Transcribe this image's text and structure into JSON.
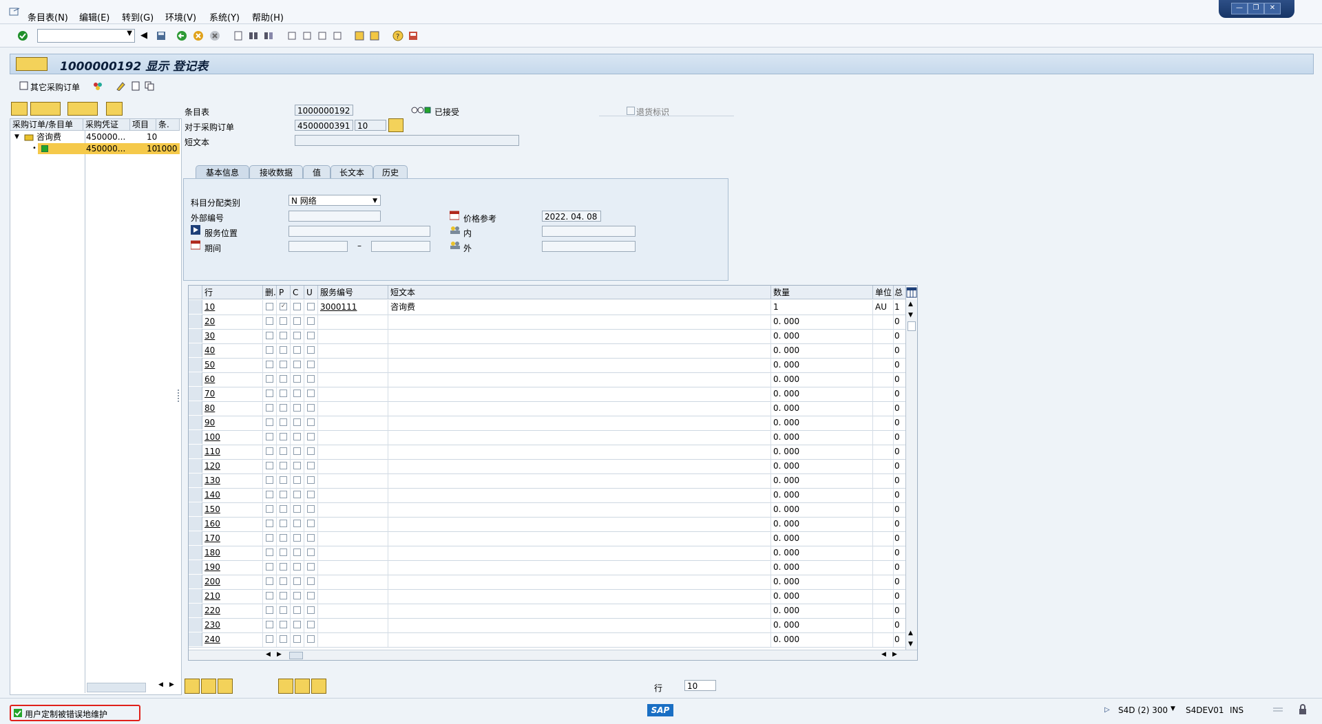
{
  "menu": {
    "items": [
      {
        "label": "条目表(N)"
      },
      {
        "label": "编辑(E)"
      },
      {
        "label": "转到(G)"
      },
      {
        "label": "环境(V)"
      },
      {
        "label": "系统(Y)"
      },
      {
        "label": "帮助(H)"
      }
    ]
  },
  "window_controls": {
    "minimize": "—",
    "restore": "❐",
    "close": "✕"
  },
  "toolbar": {
    "command_field_value": ""
  },
  "title": {
    "text": "1000000192 显示 登记表"
  },
  "app_toolbar": {
    "other_po_label": "其它采购订单"
  },
  "tree": {
    "headers": [
      "采购订单/条目单",
      "采购凭证",
      "项目",
      "条."
    ],
    "rows": [
      {
        "name": "咨询费",
        "doc": "450000...",
        "item": "10",
        "entry": ""
      },
      {
        "name": "",
        "doc": "450000...",
        "item": "10",
        "entry": "1000"
      }
    ]
  },
  "header": {
    "entry_sheet_label": "条目表",
    "entry_sheet_value": "1000000192",
    "status_label": "已接受",
    "return_label": "退货标识",
    "po_label": "对于采购订单",
    "po_value": "4500000391",
    "po_item_value": "10",
    "short_text_label": "短文本",
    "short_text_value": ""
  },
  "tabs": [
    {
      "label": "基本信息",
      "active": true
    },
    {
      "label": "接收数据",
      "active": false
    },
    {
      "label": "值",
      "active": false
    },
    {
      "label": "长文本",
      "active": false
    },
    {
      "label": "历史",
      "active": false
    }
  ],
  "basic_info": {
    "acct_assign_label": "科目分配类别",
    "acct_assign_value": "N 网络",
    "ext_number_label": "外部编号",
    "ext_number_value": "",
    "service_loc_label": "服务位置",
    "service_loc_value": "",
    "period_label": "期间",
    "period_from": "",
    "period_sep": "–",
    "period_to": "",
    "price_ref_label": "价格参考",
    "price_ref_value": "2022. 04. 08",
    "internal_label": "内",
    "internal_value": "",
    "external_label": "外",
    "external_value": ""
  },
  "table": {
    "headers": {
      "line": "行",
      "del": "删.",
      "p": "P",
      "c": "C",
      "u": "U",
      "service_no": "服务编号",
      "short_text": "短文本",
      "qty": "数量",
      "unit": "单位",
      "extra": "总"
    },
    "rows": [
      {
        "line": "10",
        "p_checked": true,
        "service_no": "3000111",
        "short_text": "咨询费",
        "qty": "1",
        "unit": "AU",
        "extra": "1"
      },
      {
        "line": "20",
        "p_checked": false,
        "service_no": "",
        "short_text": "",
        "qty": "0. 000",
        "unit": "",
        "extra": "0"
      },
      {
        "line": "30",
        "p_checked": false,
        "service_no": "",
        "short_text": "",
        "qty": "0. 000",
        "unit": "",
        "extra": "0"
      },
      {
        "line": "40",
        "p_checked": false,
        "service_no": "",
        "short_text": "",
        "qty": "0. 000",
        "unit": "",
        "extra": "0"
      },
      {
        "line": "50",
        "p_checked": false,
        "service_no": "",
        "short_text": "",
        "qty": "0. 000",
        "unit": "",
        "extra": "0"
      },
      {
        "line": "60",
        "p_checked": false,
        "service_no": "",
        "short_text": "",
        "qty": "0. 000",
        "unit": "",
        "extra": "0"
      },
      {
        "line": "70",
        "p_checked": false,
        "service_no": "",
        "short_text": "",
        "qty": "0. 000",
        "unit": "",
        "extra": "0"
      },
      {
        "line": "80",
        "p_checked": false,
        "service_no": "",
        "short_text": "",
        "qty": "0. 000",
        "unit": "",
        "extra": "0"
      },
      {
        "line": "90",
        "p_checked": false,
        "service_no": "",
        "short_text": "",
        "qty": "0. 000",
        "unit": "",
        "extra": "0"
      },
      {
        "line": "100",
        "p_checked": false,
        "service_no": "",
        "short_text": "",
        "qty": "0. 000",
        "unit": "",
        "extra": "0"
      },
      {
        "line": "110",
        "p_checked": false,
        "service_no": "",
        "short_text": "",
        "qty": "0. 000",
        "unit": "",
        "extra": "0"
      },
      {
        "line": "120",
        "p_checked": false,
        "service_no": "",
        "short_text": "",
        "qty": "0. 000",
        "unit": "",
        "extra": "0"
      },
      {
        "line": "130",
        "p_checked": false,
        "service_no": "",
        "short_text": "",
        "qty": "0. 000",
        "unit": "",
        "extra": "0"
      },
      {
        "line": "140",
        "p_checked": false,
        "service_no": "",
        "short_text": "",
        "qty": "0. 000",
        "unit": "",
        "extra": "0"
      },
      {
        "line": "150",
        "p_checked": false,
        "service_no": "",
        "short_text": "",
        "qty": "0. 000",
        "unit": "",
        "extra": "0"
      },
      {
        "line": "160",
        "p_checked": false,
        "service_no": "",
        "short_text": "",
        "qty": "0. 000",
        "unit": "",
        "extra": "0"
      },
      {
        "line": "170",
        "p_checked": false,
        "service_no": "",
        "short_text": "",
        "qty": "0. 000",
        "unit": "",
        "extra": "0"
      },
      {
        "line": "180",
        "p_checked": false,
        "service_no": "",
        "short_text": "",
        "qty": "0. 000",
        "unit": "",
        "extra": "0"
      },
      {
        "line": "190",
        "p_checked": false,
        "service_no": "",
        "short_text": "",
        "qty": "0. 000",
        "unit": "",
        "extra": "0"
      },
      {
        "line": "200",
        "p_checked": false,
        "service_no": "",
        "short_text": "",
        "qty": "0. 000",
        "unit": "",
        "extra": "0"
      },
      {
        "line": "210",
        "p_checked": false,
        "service_no": "",
        "short_text": "",
        "qty": "0. 000",
        "unit": "",
        "extra": "0"
      },
      {
        "line": "220",
        "p_checked": false,
        "service_no": "",
        "short_text": "",
        "qty": "0. 000",
        "unit": "",
        "extra": "0"
      },
      {
        "line": "230",
        "p_checked": false,
        "service_no": "",
        "short_text": "",
        "qty": "0. 000",
        "unit": "",
        "extra": "0"
      },
      {
        "line": "240",
        "p_checked": false,
        "service_no": "",
        "short_text": "",
        "qty": "0. 000",
        "unit": "",
        "extra": "0"
      }
    ]
  },
  "bottom": {
    "row_label": "行",
    "row_value": "10"
  },
  "status": {
    "message": "用户定制被错误地维护",
    "logo": "SAP",
    "system": "S4D (2) 300",
    "server": "S4DEV01",
    "mode": "INS"
  },
  "colors": {
    "accent": "#1d3f78",
    "status_ok": "#25a52a",
    "highlight": "#f5c94a",
    "warning_border": "#e0201a"
  }
}
